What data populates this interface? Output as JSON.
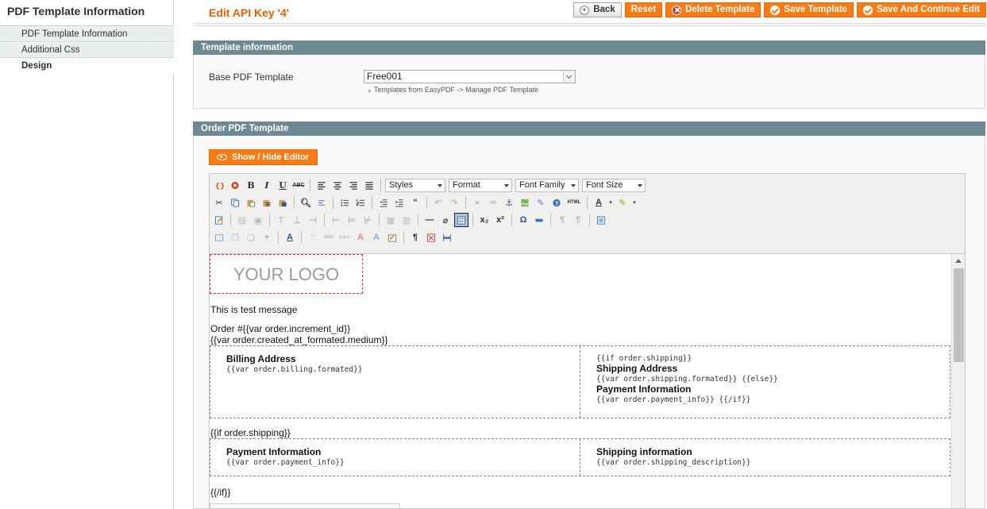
{
  "sidebar": {
    "title": "PDF Template Information",
    "items": [
      {
        "label": "PDF Template Information"
      },
      {
        "label": "Additional Css"
      },
      {
        "label": "Design"
      }
    ]
  },
  "header": {
    "title": "Edit API Key '4'",
    "buttons": {
      "back": "Back",
      "reset": "Reset",
      "delete": "Delete Template",
      "save": "Save Template",
      "save_continue": "Save And Continue Edit"
    }
  },
  "template_info": {
    "heading": "Template information",
    "base_label": "Base PDF Template",
    "base_value": "Free001",
    "note": "Templates from EasyPDF -> Manage PDF Template"
  },
  "order_pdf": {
    "heading": "Order PDF Template",
    "toggle_label": "Show / Hide Editor"
  },
  "toolbar": {
    "styles": "Styles",
    "format": "Format",
    "font_family": "Font Family",
    "font_size": "Font Size",
    "bold": "B",
    "italic": "I",
    "underline": "U",
    "strike": "ABC",
    "html": "HTML",
    "text_color": "A"
  },
  "content": {
    "logo": "YOUR LOGO",
    "message": "This is test message",
    "order_line": "Order #{{var order.increment_id}}",
    "created_line": "{{var order.created_at_formated.medium}}",
    "table1": {
      "left_title": "Billing Address",
      "left_value": "{{var order.billing.formated}}",
      "right_if": "{{if order.shipping}}",
      "right_title1": "Shipping Address",
      "right_value1": "{{var order.shipping.formated}} {{else}}",
      "right_title2": "Payment Information",
      "right_value2": "{{var order.payment_info}} {{/if}}"
    },
    "if_shipping": "{{if order.shipping}}",
    "table2": {
      "left_title": "Payment Information",
      "left_value": "{{var order.payment_info}}",
      "right_title": "Shipping information",
      "right_value": "{{var order.shipping_description}}"
    },
    "endif": "{{/if}}"
  },
  "colors": {
    "accent": "#eb5e00",
    "button": "#f77c16",
    "section_header": "#6f8992"
  }
}
